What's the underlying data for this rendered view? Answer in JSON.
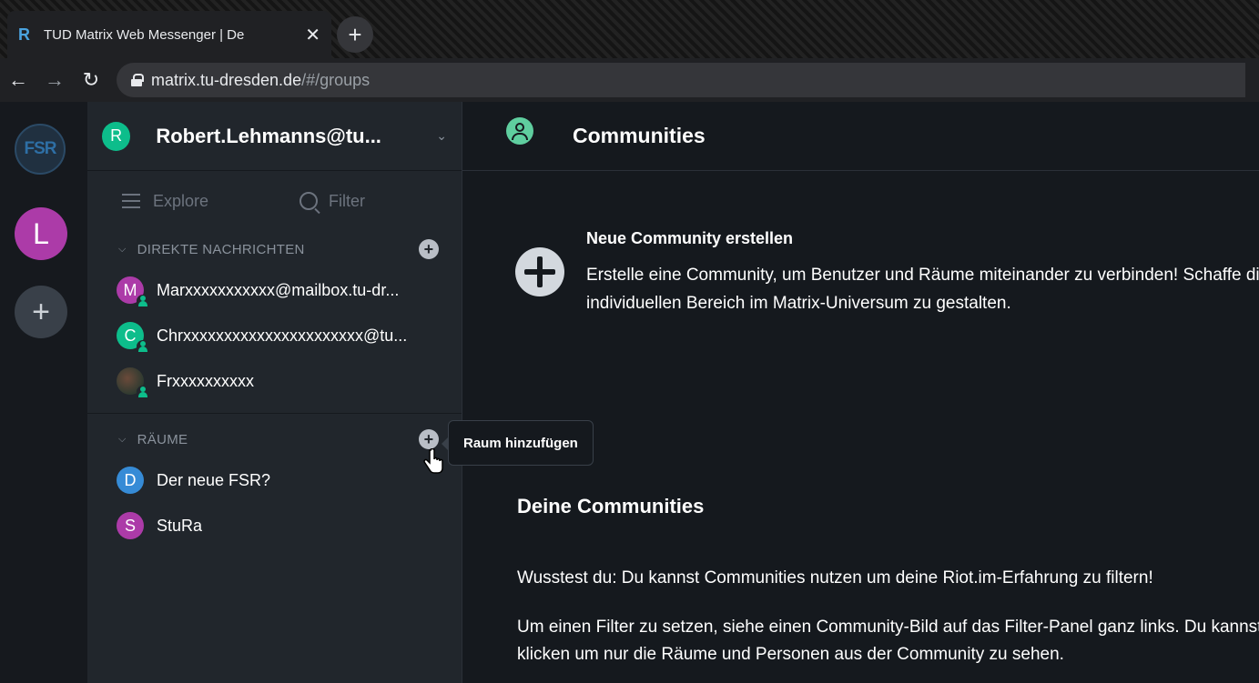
{
  "browser": {
    "tab_title": "TUD Matrix Web Messenger | De",
    "url_host": "matrix.tu-dresden.de",
    "url_path": "/#/groups"
  },
  "leftbar": {
    "logo_text": "FSR",
    "community_avatar_letter": "L"
  },
  "user": {
    "avatar_letter": "R",
    "name": "Robert.Lehmanns@tu..."
  },
  "roomlist": {
    "explore_label": "Explore",
    "filter_label": "Filter",
    "dm_section": "DIREKTE NACHRICHTEN",
    "dms": [
      {
        "letter": "M",
        "name": "Marxxxxxxxxxxx@mailbox.tu-dr...",
        "color": "#ac3ba8"
      },
      {
        "letter": "C",
        "name": "Chrxxxxxxxxxxxxxxxxxxxxxx@tu...",
        "color": "#0dbd8b"
      },
      {
        "letter": "",
        "name": "Frxxxxxxxxxx",
        "color": "#2e3a30"
      }
    ],
    "rooms_section": "RÄUME",
    "rooms": [
      {
        "letter": "D",
        "name": "Der neue FSR?",
        "color": "#368bd6"
      },
      {
        "letter": "S",
        "name": "StuRa",
        "color": "#ac3ba8"
      }
    ],
    "tooltip": "Raum hinzufügen"
  },
  "main": {
    "title": "Communities",
    "create_title": "Neue Community erstellen",
    "create_desc_1": "Erstelle eine Community, um Benutzer und Räume miteinander zu verbinden! Schaffe dir einen",
    "create_desc_2": "individuellen Bereich im Matrix-Universum zu gestalten.",
    "your_title": "Deine Communities",
    "info_1": "Wusstest du: Du kannst Communities nutzen um deine Riot.im-Erfahrung zu filtern!",
    "info_2a": "Um einen Filter zu setzen, siehe einen Community-Bild auf das Filter-Panel ganz links. Du kannst",
    "info_2b": "klicken um nur die Räume und Personen aus der Community zu sehen."
  }
}
